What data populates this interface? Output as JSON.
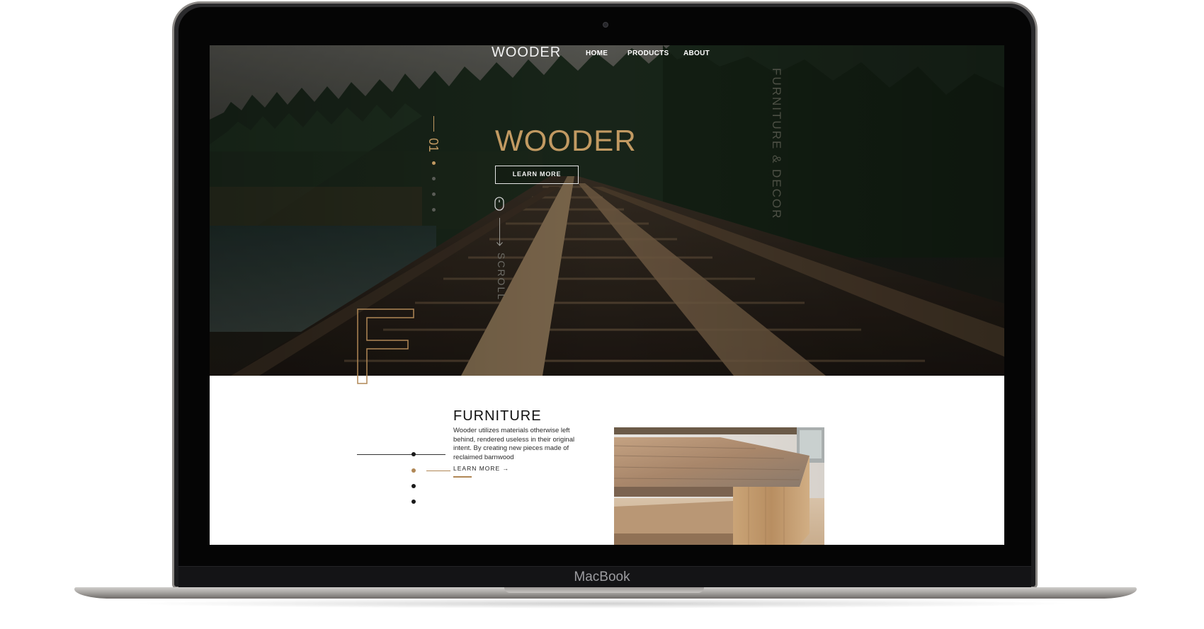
{
  "device": {
    "brand_label": "MacBook"
  },
  "nav": {
    "logo": "WOODER",
    "links": [
      "HOME",
      "PRODUCTS",
      "ABOUT"
    ]
  },
  "hero": {
    "title": "WOODER",
    "button_label": "LEARN MORE",
    "slide_number": "01",
    "scroll_label": "SCROLL",
    "side_tag": "FURNITURE & DECOR",
    "accent_color": "#c29a62"
  },
  "section": {
    "outline_letter": "F",
    "title": "FURNITURE",
    "body": "Wooder utilizes materials otherwise left behind, rendered useless in their original intent. By creating new pieces made of reclaimed barnwood",
    "link_label": "LEARN MORE →",
    "accent_color": "#b08756"
  },
  "icons": [
    "mouse-icon",
    "arrow-down-icon",
    "arrow-right-icon"
  ]
}
